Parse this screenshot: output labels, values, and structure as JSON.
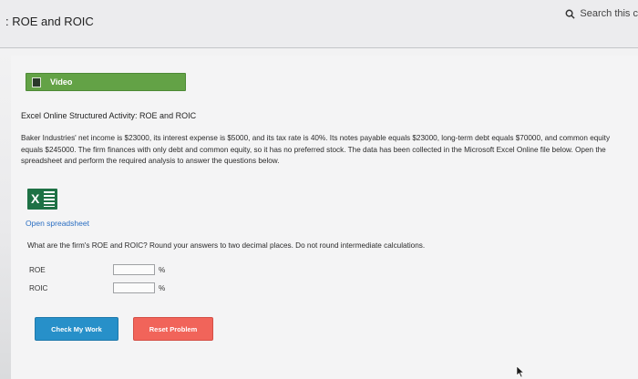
{
  "search": {
    "label": "Search this c"
  },
  "page": {
    "title": ": ROE and ROIC"
  },
  "video": {
    "label": "Video"
  },
  "activity": {
    "title": "Excel Online Structured Activity: ROE and ROIC",
    "body": "Baker Industries' net income is $23000, its interest expense is $5000, and its tax rate is 40%. Its notes payable equals $23000, long-term debt equals $70000, and common equity equals $245000. The firm finances with only debt and common equity, so it has no preferred stock. The data has been collected in the Microsoft Excel Online file below. Open the spreadsheet and perform the required analysis to answer the questions below.",
    "open_link": "Open spreadsheet",
    "question": "What are the firm's ROE and ROIC? Round your answers to two decimal places. Do not round intermediate calculations.",
    "answers": [
      {
        "label": "ROE",
        "value": "",
        "unit": "%"
      },
      {
        "label": "ROIC",
        "value": "",
        "unit": "%"
      }
    ]
  },
  "buttons": {
    "check": "Check My Work",
    "reset": "Reset Problem"
  },
  "colors": {
    "video_green": "#63a246",
    "link_blue": "#2a6ec2",
    "check_blue": "#2790c9",
    "reset_red": "#f1645a",
    "excel_green": "#1e7145"
  },
  "icons": [
    "search-icon",
    "video-icon",
    "excel-icon",
    "mouse-cursor-icon"
  ]
}
